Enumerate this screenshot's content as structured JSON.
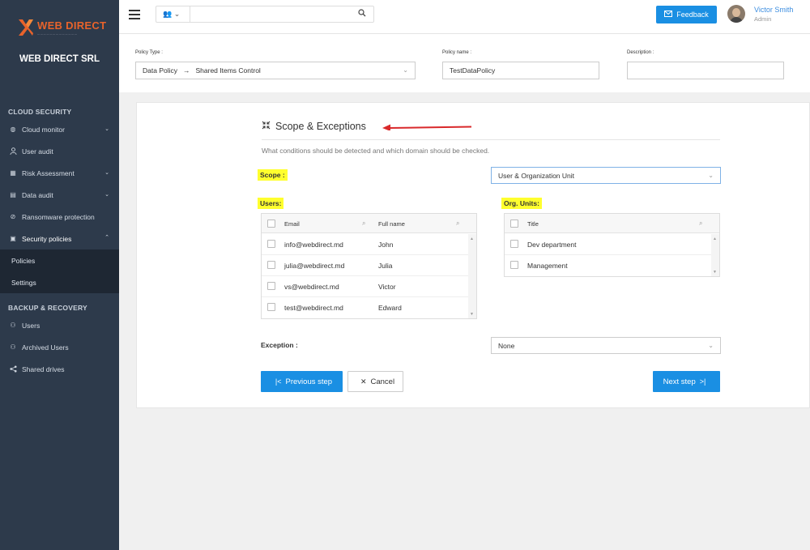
{
  "brand": {
    "logo_text": "WEB DIRECT",
    "company": "WEB DIRECT SRL"
  },
  "sidebar": {
    "sections": [
      {
        "title": "CLOUD SECURITY"
      },
      {
        "title": "BACKUP & RECOVERY"
      }
    ],
    "items": [
      {
        "label": "Cloud monitor",
        "icon": "globe-icon"
      },
      {
        "label": "User audit",
        "icon": "user-icon"
      },
      {
        "label": "Risk Assessment",
        "icon": "grid-icon"
      },
      {
        "label": "Data audit",
        "icon": "document-icon"
      },
      {
        "label": "Ransomware protection",
        "icon": "shield-icon"
      },
      {
        "label": "Security policies",
        "icon": "policy-icon"
      },
      {
        "label": "Users",
        "icon": "users-icon"
      },
      {
        "label": "Archived Users",
        "icon": "archived-users-icon"
      },
      {
        "label": "Shared drives",
        "icon": "share-icon"
      }
    ],
    "subitems": [
      "Policies",
      "Settings"
    ]
  },
  "topbar": {
    "search_placeholder": "",
    "feedback_label": "Feedback",
    "user_name": "Victor Smith",
    "user_role": "Admin"
  },
  "policy": {
    "type_label": "Policy Type :",
    "type_value_1": "Data Policy",
    "type_arrow": "→",
    "type_value_2": "Shared Items Control",
    "name_label": "Policy name :",
    "name_value": "TestDataPolicy",
    "desc_label": "Description :",
    "desc_value": ""
  },
  "main": {
    "title": "Scope & Exceptions",
    "description": "What conditions should be detected and which domain should be checked.",
    "scope_label": "Scope :",
    "scope_value": "User & Organization Unit",
    "users_label": "Users:",
    "org_label": "Org. Units:",
    "users_table": {
      "columns": [
        "Email",
        "Full name"
      ],
      "rows": [
        {
          "email": "info@webdirect.md",
          "name": "John"
        },
        {
          "email": "julia@webdirect.md",
          "name": "Julia"
        },
        {
          "email": "vs@webdirect.md",
          "name": "Victor"
        },
        {
          "email": "test@webdirect.md",
          "name": "Edward"
        }
      ]
    },
    "org_table": {
      "columns": [
        "Title"
      ],
      "rows": [
        "Dev department",
        "Management"
      ]
    },
    "exception_label": "Exception :",
    "exception_value": "None",
    "prev_button": "Previous step",
    "cancel_button": "Cancel",
    "next_button": "Next step"
  },
  "colors": {
    "sidebar_bg": "#2d3a4b",
    "accent": "#1a8fe3",
    "highlight": "#ffff2e",
    "annotation_arrow": "#d9292b"
  }
}
